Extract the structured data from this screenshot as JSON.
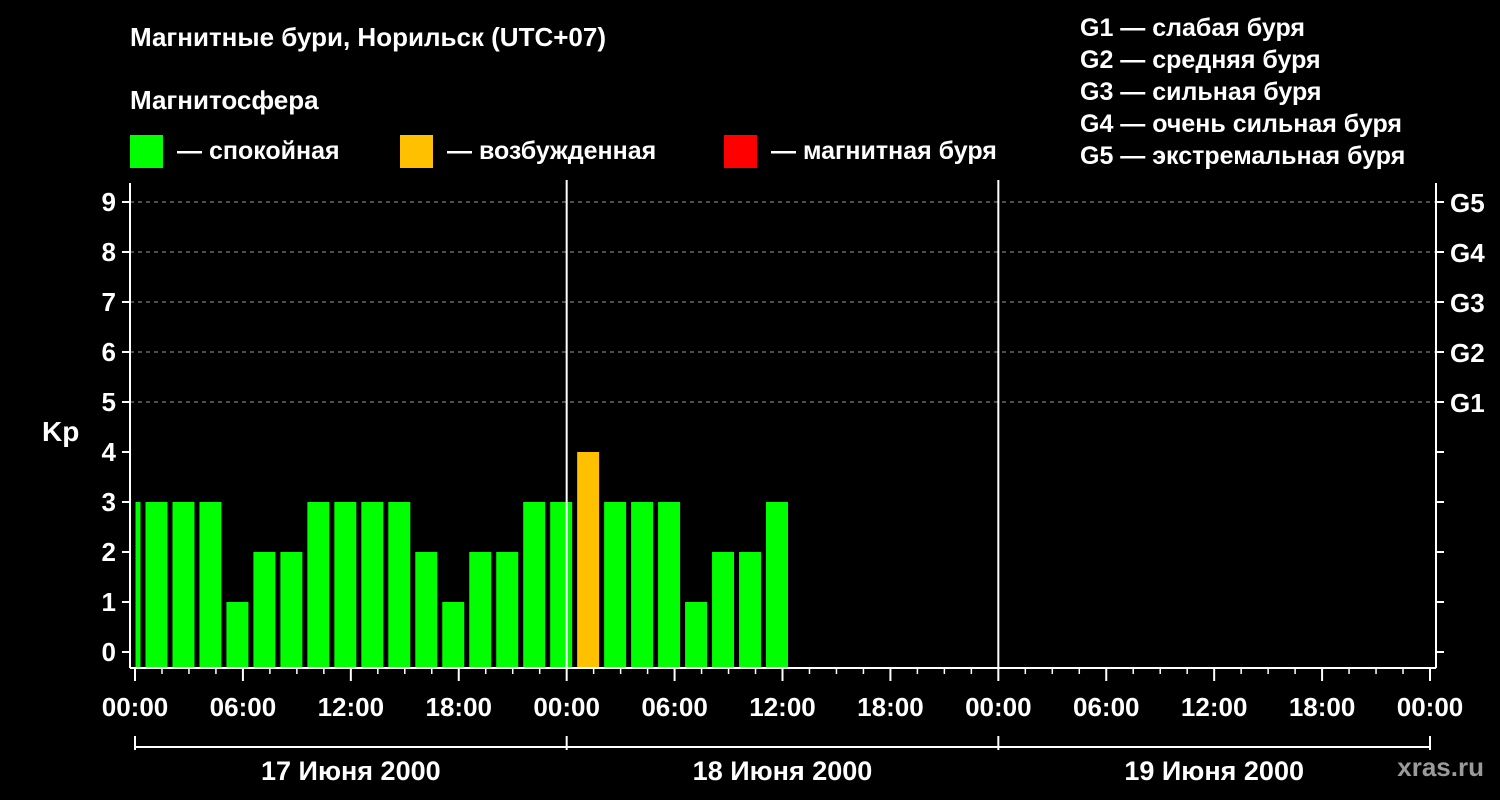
{
  "title": "Магнитные бури, Норильск (UTC+07)",
  "legend": {
    "title": "Магнитосфера",
    "items": [
      {
        "label": "— спокойная",
        "color": "#00ff00"
      },
      {
        "label": "— возбужденная",
        "color": "#ffc000"
      },
      {
        "label": "— магнитная буря",
        "color": "#ff0000"
      }
    ]
  },
  "g_scale": [
    "G1 — слабая буря",
    "G2 — средняя буря",
    "G3 — сильная буря",
    "G4 — очень сильная буря",
    "G5 — экстремальная буря"
  ],
  "watermark": "xras.ru",
  "chart_data": {
    "type": "bar",
    "ylabel": "Kp",
    "ylim": [
      0,
      9
    ],
    "y_ticks": [
      "0",
      "1",
      "2",
      "3",
      "4",
      "5",
      "6",
      "7",
      "8",
      "9"
    ],
    "right_ticks": [
      {
        "value": 5,
        "label": "G1"
      },
      {
        "value": 6,
        "label": "G2"
      },
      {
        "value": 7,
        "label": "G3"
      },
      {
        "value": 8,
        "label": "G4"
      },
      {
        "value": 9,
        "label": "G5"
      }
    ],
    "grid": "dashed horizontal at 5–9",
    "x_ticks": [
      "00:00",
      "06:00",
      "12:00",
      "18:00",
      "00:00",
      "06:00",
      "12:00",
      "18:00",
      "00:00",
      "06:00",
      "12:00",
      "18:00",
      "00:00"
    ],
    "days": [
      "17 Июня 2000",
      "18 Июня 2000",
      "19 Июня 2000"
    ],
    "bar_interval_hours": 3,
    "first_bar_start_hour": -2,
    "values": [
      3,
      3,
      3,
      3,
      1,
      2,
      2,
      3,
      3,
      3,
      3,
      2,
      1,
      2,
      2,
      3,
      3,
      4,
      3,
      3,
      3,
      1,
      2,
      2,
      3
    ],
    "colors": {
      "quiet": "#00ff00",
      "active": "#ffc000",
      "storm": "#ff0000"
    }
  }
}
